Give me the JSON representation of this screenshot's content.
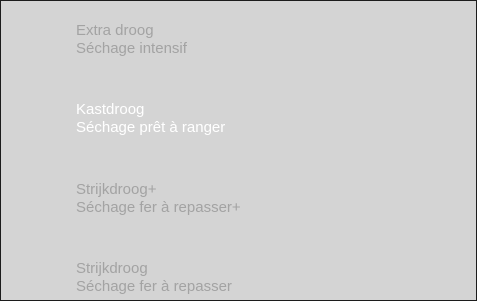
{
  "options": [
    {
      "nl": "Extra droog",
      "fr": "Séchage intensif",
      "selected": false
    },
    {
      "nl": "Kastdroog",
      "fr": "Séchage prêt à ranger",
      "selected": true
    },
    {
      "nl": "Strijkdroog+",
      "fr": "Séchage fer à repasser+",
      "selected": false
    },
    {
      "nl": "Strijkdroog",
      "fr": "Séchage fer à repasser",
      "selected": false
    }
  ],
  "colors": {
    "background": "#d4d4d4",
    "inactive_text": "#a3a3a3",
    "selected_text": "#ffffff",
    "border": "#1c1c1c"
  }
}
